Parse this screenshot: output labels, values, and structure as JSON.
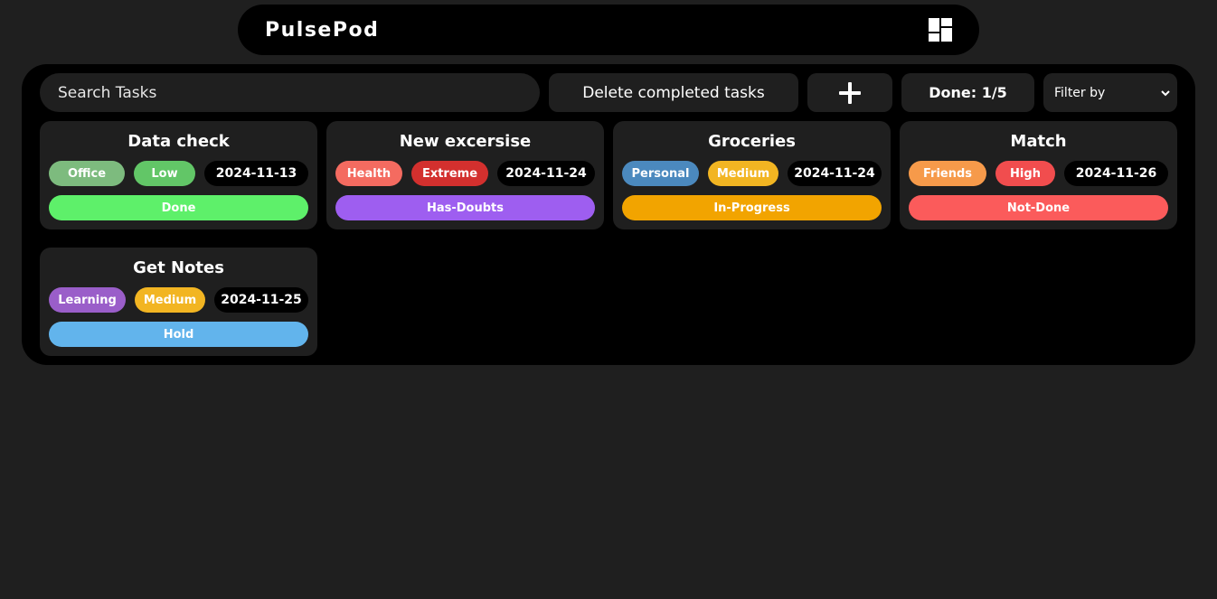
{
  "header": {
    "title": "PulsePod",
    "icon": "dashboard-layout-icon"
  },
  "toolbar": {
    "search_placeholder": "Search Tasks",
    "delete_label": "Delete completed tasks",
    "add_icon": "plus-icon",
    "done_label": "Done: 1/5",
    "filter_label": "Filter by",
    "filter_icon": "chevron-down-icon"
  },
  "tasks": [
    {
      "title": "Data check",
      "category": "Office",
      "category_color": "#7dbb7e",
      "priority": "Low",
      "priority_color": "#62c667",
      "date": "2024-11-13",
      "status": "Done",
      "status_color": "#5ef06a"
    },
    {
      "title": "New excersise",
      "category": "Health",
      "category_color": "#f46b60",
      "priority": "Extreme",
      "priority_color": "#d3302e",
      "date": "2024-11-24",
      "status": "Has-Doubts",
      "status_color": "#9e5ef0"
    },
    {
      "title": "Groceries",
      "category": "Personal",
      "category_color": "#4b89be",
      "priority": "Medium",
      "priority_color": "#f2b522",
      "date": "2024-11-24",
      "status": "In-Progress",
      "status_color": "#f2a400"
    },
    {
      "title": "Match",
      "category": "Friends",
      "category_color": "#f69a4a",
      "priority": "High",
      "priority_color": "#f14d4e",
      "date": "2024-11-26",
      "status": "Not-Done",
      "status_color": "#fb5b5b"
    },
    {
      "title": "Get Notes",
      "category": "Learning",
      "category_color": "#9a5ec9",
      "priority": "Medium",
      "priority_color": "#f2b522",
      "date": "2024-11-25",
      "status": "Hold",
      "status_color": "#62b4ec"
    }
  ]
}
